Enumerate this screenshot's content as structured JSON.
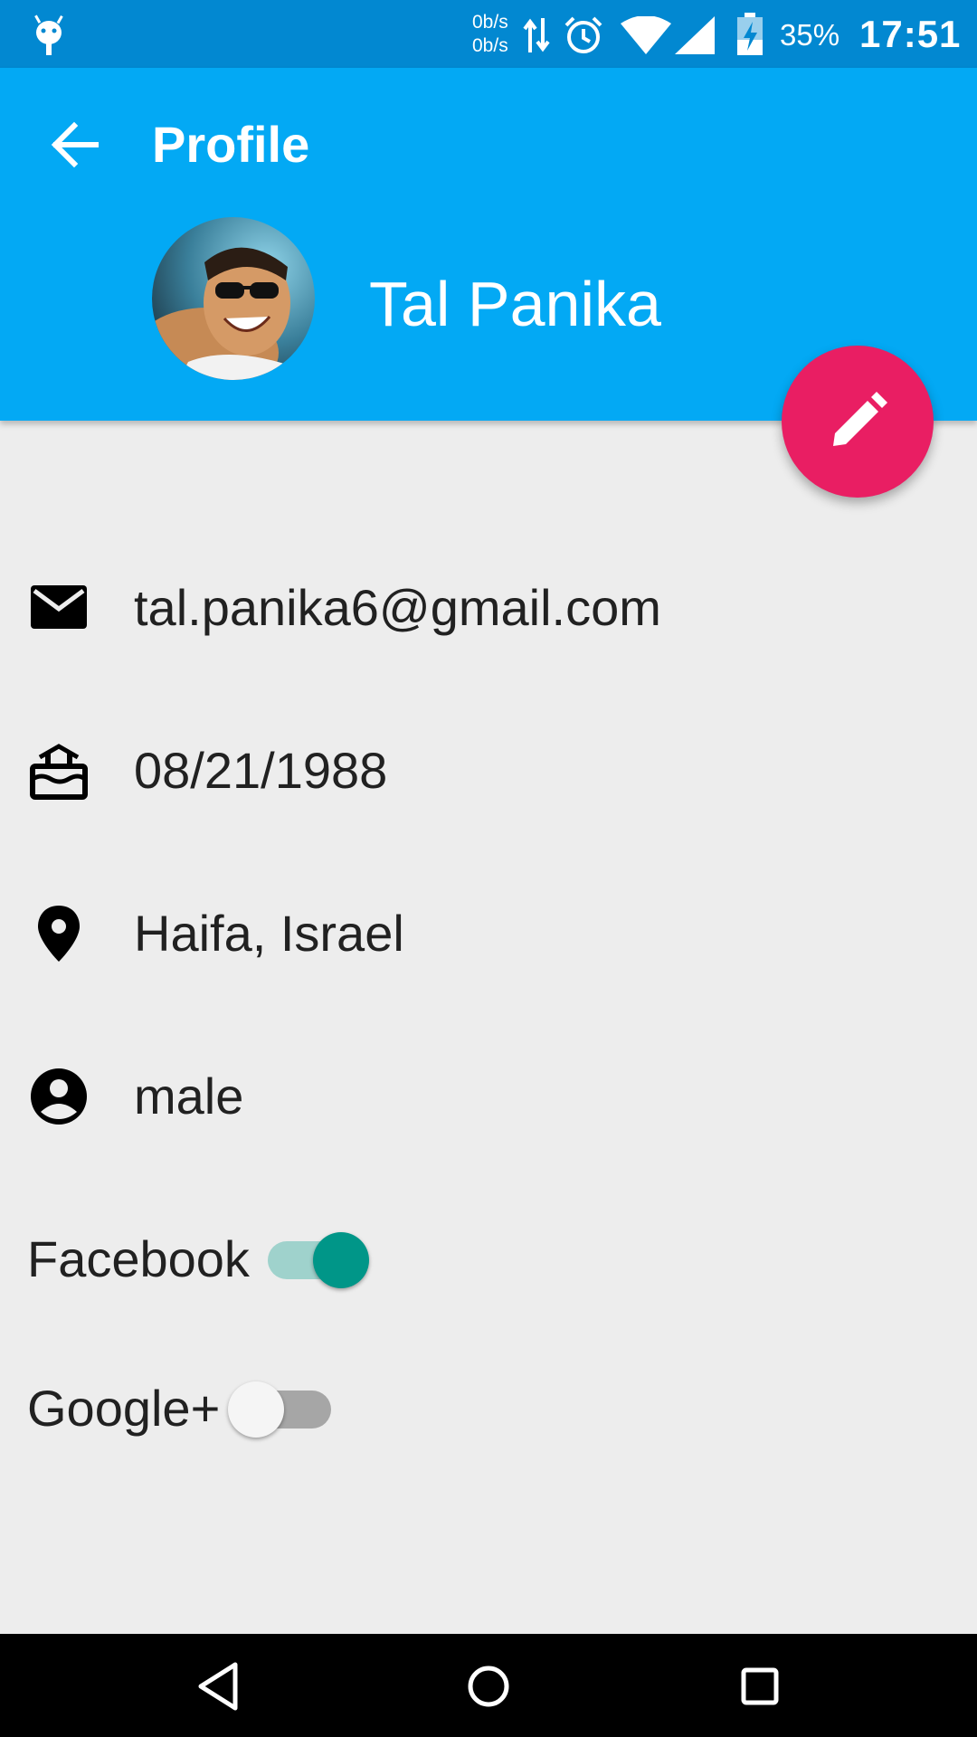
{
  "status_bar": {
    "net_up": "0b/s",
    "net_down": "0b/s",
    "battery": "35%",
    "time": "17:51",
    "icons": [
      "android-icon",
      "data-arrows-icon",
      "alarm-icon",
      "wifi-icon",
      "signal-icon",
      "battery-icon"
    ]
  },
  "appbar": {
    "title": "Profile",
    "back_icon": "arrow-back-icon",
    "color": "#03a9f4"
  },
  "profile": {
    "name": "Tal Panika",
    "avatar": "avatar-photo"
  },
  "fab": {
    "icon": "pencil-icon",
    "color": "#e91e63"
  },
  "info": [
    {
      "icon": "email-icon",
      "value": "tal.panika6@gmail.com"
    },
    {
      "icon": "cake-icon",
      "value": "08/21/1988"
    },
    {
      "icon": "location-pin-icon",
      "value": "Haifa, Israel"
    },
    {
      "icon": "account-circle-icon",
      "value": "male"
    }
  ],
  "toggles": [
    {
      "label": "Facebook",
      "on": true,
      "accent": "#009688"
    },
    {
      "label": "Google+",
      "on": false
    }
  ],
  "navbar": {
    "icons": [
      "back-triangle-icon",
      "home-circle-icon",
      "recents-square-icon"
    ]
  }
}
